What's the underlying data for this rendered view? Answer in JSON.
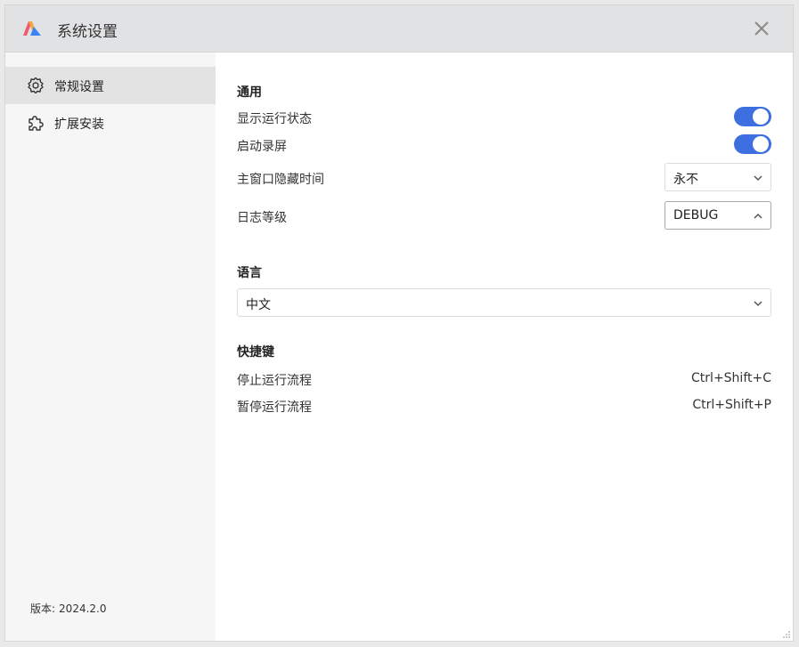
{
  "window": {
    "title": "系统设置"
  },
  "sidebar": {
    "items": [
      {
        "label": "常规设置",
        "icon": "gear-icon",
        "active": true
      },
      {
        "label": "扩展安装",
        "icon": "puzzle-icon",
        "active": false
      }
    ],
    "version_label": "版本:",
    "version_value": "2024.2.0"
  },
  "general": {
    "title": "通用",
    "show_status": {
      "label": "显示运行状态",
      "enabled": true
    },
    "screen_record": {
      "label": "启动录屏",
      "enabled": true
    },
    "hide_time": {
      "label": "主窗口隐藏时间",
      "value": "永不"
    },
    "log_level": {
      "label": "日志等级",
      "value": "DEBUG"
    }
  },
  "language": {
    "title": "语言",
    "value": "中文"
  },
  "shortcuts": {
    "title": "快捷键",
    "items": [
      {
        "label": "停止运行流程",
        "keys": "Ctrl+Shift+C"
      },
      {
        "label": "暂停运行流程",
        "keys": "Ctrl+Shift+P"
      }
    ]
  },
  "colors": {
    "accent": "#3d6fe0",
    "titlebar": "#e1e2e4",
    "sidebar": "#f6f6f6"
  }
}
